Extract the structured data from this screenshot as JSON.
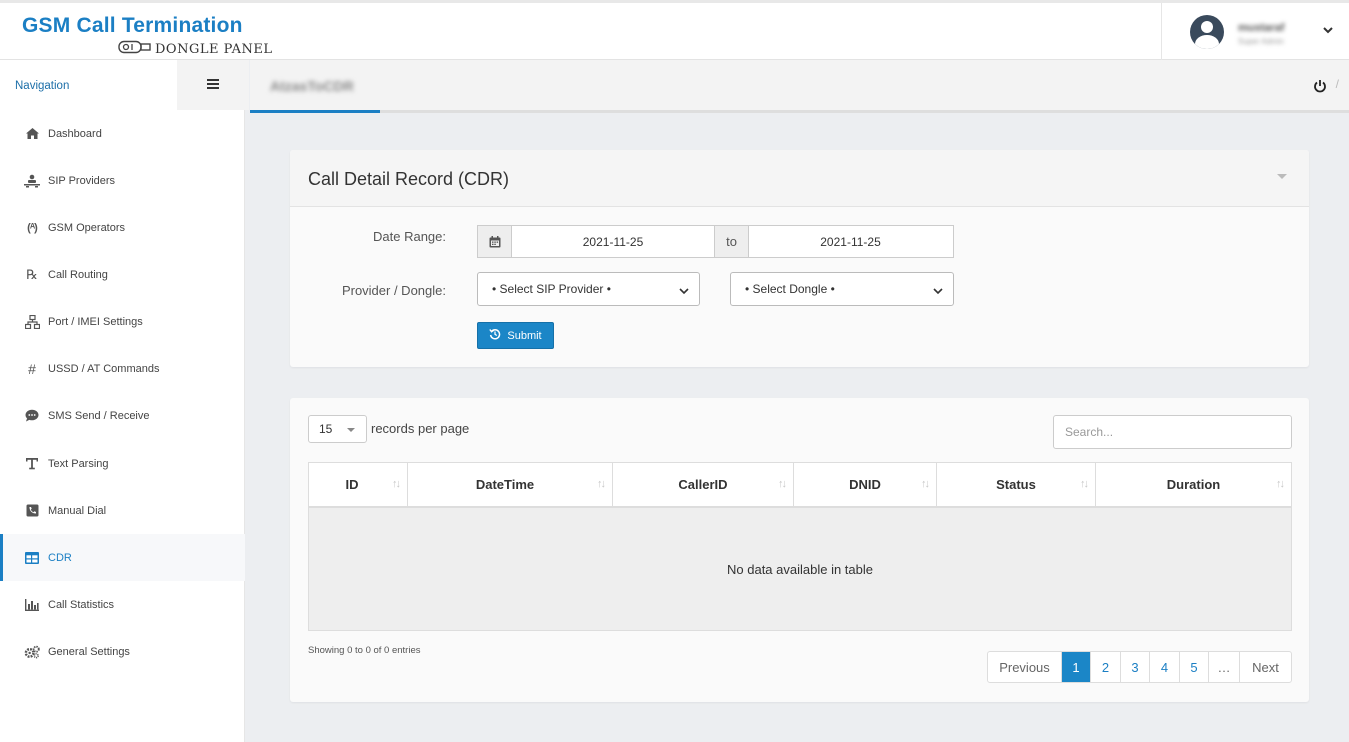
{
  "app": {
    "logo_title": "GSM Call Termination",
    "logo_subtitle": "DONGLE PANEL",
    "user_name": "mustaraf",
    "user_role": "Super Admin"
  },
  "sidebar": {
    "header": "Navigation",
    "items": [
      {
        "label": "Dashboard",
        "icon": "home-icon"
      },
      {
        "label": "SIP Providers",
        "icon": "sip-icon"
      },
      {
        "label": "GSM Operators",
        "icon": "antenna-icon"
      },
      {
        "label": "Call Routing",
        "icon": "routing-icon"
      },
      {
        "label": "Port / IMEI Settings",
        "icon": "network-icon"
      },
      {
        "label": "USSD / AT Commands",
        "icon": "hash-icon"
      },
      {
        "label": "SMS Send / Receive",
        "icon": "sms-icon"
      },
      {
        "label": "Text Parsing",
        "icon": "text-icon"
      },
      {
        "label": "Manual Dial",
        "icon": "dial-icon"
      },
      {
        "label": "CDR",
        "icon": "table-icon",
        "active": true
      },
      {
        "label": "Call Statistics",
        "icon": "bar-chart-icon"
      },
      {
        "label": "General Settings",
        "icon": "gears-icon"
      }
    ]
  },
  "content_header": {
    "tab_label": "AtzasToCDR",
    "separator": "/"
  },
  "cdr_panel": {
    "title": "Call Detail Record (CDR)",
    "date_range_label": "Date Range:",
    "date_from": "2021-11-25",
    "to_label": "to",
    "date_to": "2021-11-25",
    "provider_label": "Provider / Dongle:",
    "sip_provider_select": "• Select SIP Provider •",
    "dongle_select": "• Select Dongle •",
    "submit_label": "Submit"
  },
  "table_panel": {
    "page_length": "15",
    "records_per_page": "records per page",
    "search_placeholder": "Search...",
    "columns": [
      "ID",
      "DateTime",
      "CallerID",
      "DNID",
      "Status",
      "Duration"
    ],
    "empty_message": "No data available in table",
    "info": "Showing 0 to 0 of 0 entries",
    "pagination": {
      "previous": "Previous",
      "pages": [
        "1",
        "2",
        "3",
        "4",
        "5"
      ],
      "ellipsis": "…",
      "next": "Next",
      "current": "1"
    }
  },
  "colors": {
    "accent": "#1b7fc4",
    "button": "#1b86c7"
  }
}
